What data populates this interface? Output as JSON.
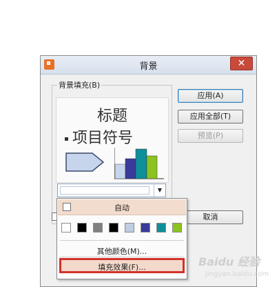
{
  "dialog": {
    "title": "背景",
    "close_symbol": "✕",
    "group_label": "背景填充(B)",
    "preview": {
      "title": "标题",
      "bullet": "项目符号"
    },
    "buttons": {
      "apply": "应用(A)",
      "apply_all": "应用全部(T)",
      "preview": "预览(P)",
      "cancel": "取消"
    }
  },
  "dropdown": {
    "auto_label": "自动",
    "swatch_colors": [
      "#ffffff",
      "#000000",
      "#808080",
      "#000000",
      "#c0cde2",
      "#3a3a9a",
      "#0f8f9a",
      "#8cc31f"
    ],
    "more_colors": "其他颜色(M)...",
    "fill_effects": "填充效果(F)..."
  },
  "watermark": {
    "text": "Baidu 经验",
    "subtext": "jingyan.baidu.com"
  }
}
